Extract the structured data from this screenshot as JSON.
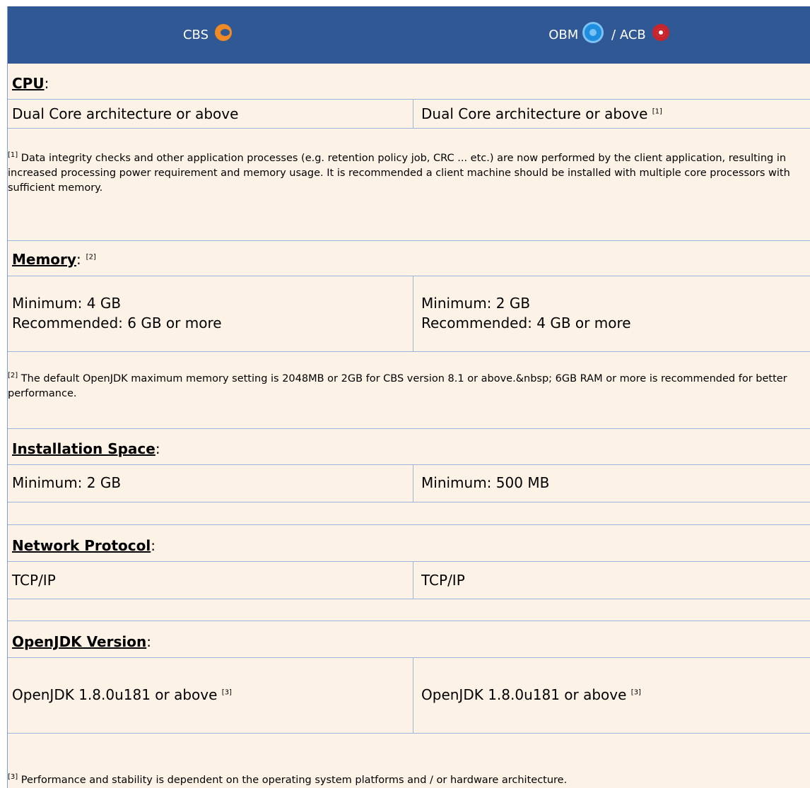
{
  "header": {
    "col1_label": "CBS",
    "col1_icon": "cbs-logo-icon",
    "col2_label": "OBM",
    "col2_separator": " / ACB",
    "col2_icons": [
      "obm-logo-icon",
      "acb-logo-icon"
    ],
    "background_color": "#305894"
  },
  "sections": {
    "cpu": {
      "title": "CPU",
      "colon": ":",
      "cbs": "Dual Core architecture or above",
      "obm": "Dual Core architecture or above",
      "obm_ref": "[1]"
    },
    "memory": {
      "title": "Memory",
      "colon": ":",
      "ref": "[2]",
      "cbs_min": "Minimum: 4 GB",
      "cbs_rec": "Recommended: 6 GB or more",
      "obm_min": "Minimum: 2 GB",
      "obm_rec": "Recommended: 4 GB or more"
    },
    "installation": {
      "title": "Installation Space",
      "colon": ":",
      "cbs": "Minimum: 2 GB",
      "obm": "Minimum: 500 MB"
    },
    "network": {
      "title": "Network Protocol",
      "colon": ":",
      "cbs": "TCP/IP",
      "obm": "TCP/IP"
    },
    "openjdk": {
      "title": "OpenJDK Version",
      "colon": ":",
      "cbs": "OpenJDK 1.8.0u181 or above",
      "cbs_ref": "[3]",
      "obm": "OpenJDK 1.8.0u181 or above",
      "obm_ref": "[3]"
    }
  },
  "notes": {
    "n1_ref": "[1]",
    "n1_text": " Data integrity checks and other application processes (e.g. retention policy job, CRC ... etc.) are now performed by the client application, resulting in increased processing power requirement and memory usage.  It is recommended a client machine should be installed with multiple core processors with sufficient memory.",
    "n2_ref": "[2]",
    "n2_text": " The default OpenJDK maximum memory setting is 2048MB or 2GB for CBS version 8.1 or above.&nbsp; 6GB RAM or more is recommended for better performance.",
    "n3_ref": "[3]",
    "n3_text": " Performance and stability is dependent on the operating system platforms and / or hardware architecture."
  }
}
